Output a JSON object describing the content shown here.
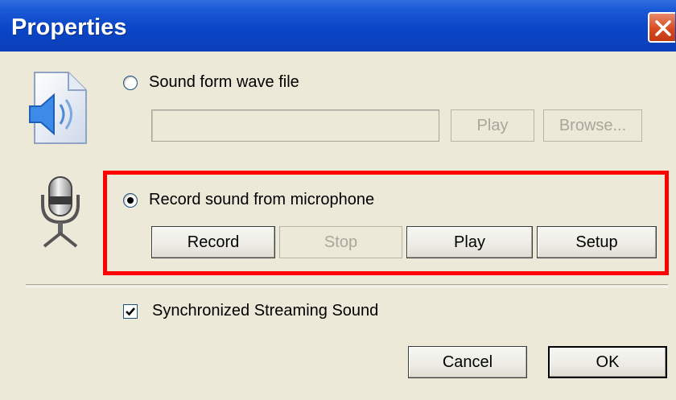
{
  "window": {
    "title": "Properties",
    "close_icon": "close-icon"
  },
  "wave_option": {
    "label": "Sound form wave file",
    "selected": false,
    "path_value": "",
    "play_label": "Play",
    "browse_label": "Browse...",
    "icon": "sound-file-icon"
  },
  "mic_option": {
    "label": "Record sound from microphone",
    "selected": true,
    "record_label": "Record",
    "stop_label": "Stop",
    "play_label": "Play",
    "setup_label": "Setup",
    "icon": "microphone-icon",
    "highlight_color": "#ff0000"
  },
  "sync": {
    "label": "Synchronized Streaming Sound",
    "checked": true
  },
  "footer": {
    "cancel_label": "Cancel",
    "ok_label": "OK"
  },
  "colors": {
    "titlebar": "#0a46c8",
    "dialog_bg": "#ece9d8",
    "close": "#d94a1f"
  }
}
